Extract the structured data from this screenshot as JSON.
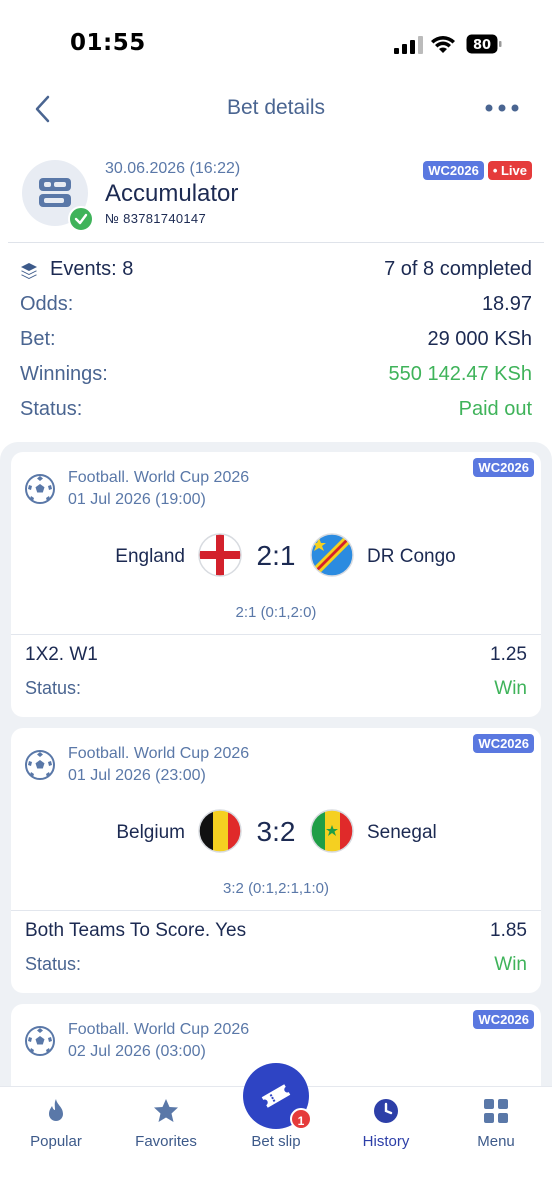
{
  "status_bar": {
    "time": "01:55",
    "battery": "80"
  },
  "header": {
    "title": "Bet details"
  },
  "bet": {
    "date": "30.06.2026 (16:22)",
    "type": "Accumulator",
    "number": "№ 83781740147",
    "tag": "WC2026",
    "live": "• Live"
  },
  "summary": {
    "events_label": "Events: 8",
    "events_value": "7 of 8 completed",
    "odds_label": "Odds:",
    "odds_value": "18.97",
    "bet_label": "Bet:",
    "bet_value": "29 000 KSh",
    "winnings_label": "Winnings:",
    "winnings_value": "550 142.47 KSh",
    "status_label": "Status:",
    "status_value": "Paid out"
  },
  "events": [
    {
      "league": "Football. World Cup 2026",
      "kickoff": "01 Jul 2026 (19:00)",
      "tag": "WC2026",
      "home": "England",
      "away": "DR Congo",
      "score": "2:1",
      "detail": "2:1 (0:1,2:0)",
      "market": "1X2. W1",
      "odd": "1.25",
      "status_label": "Status:",
      "status": "Win"
    },
    {
      "league": "Football. World Cup 2026",
      "kickoff": "01 Jul 2026 (23:00)",
      "tag": "WC2026",
      "home": "Belgium",
      "away": "Senegal",
      "score": "3:2",
      "detail": "3:2 (0:1,2:1,1:0)",
      "market": "Both Teams To Score. Yes",
      "odd": "1.85",
      "status_label": "Status:",
      "status": "Win"
    },
    {
      "league": "Football. World Cup 2026",
      "kickoff": "02 Jul 2026 (03:00)",
      "tag": "WC2026"
    }
  ],
  "nav": {
    "popular": "Popular",
    "favorites": "Favorites",
    "betslip": "Bet slip",
    "betslip_count": "1",
    "history": "History",
    "menu": "Menu"
  },
  "colors": {
    "accent": "#2e44c4",
    "win": "#3fb35a",
    "live": "#e53b3b",
    "tag": "#5a78e0"
  }
}
